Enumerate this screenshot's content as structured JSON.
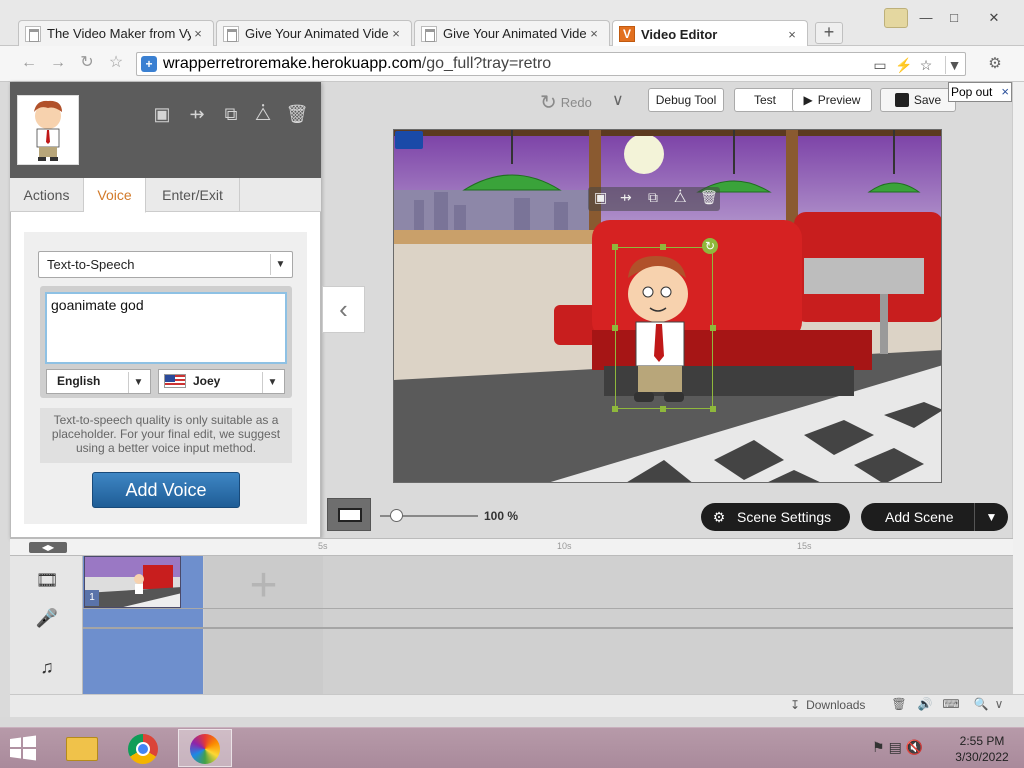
{
  "browser": {
    "tabs": [
      {
        "title": "The Video Maker from Vy",
        "active": false
      },
      {
        "title": "Give Your Animated Videc",
        "active": false
      },
      {
        "title": "Give Your Animated Videc",
        "active": false
      },
      {
        "title": "Video Editor",
        "active": true
      }
    ],
    "tab_close": "×",
    "new_tab": "+",
    "window_controls": {
      "minimize": "—",
      "maximize": "□",
      "close": "✕"
    },
    "url_host": "wrapperretroremake.herokuapp.com",
    "url_path": "/go_full?tray=retro"
  },
  "editor_toolbar": {
    "redo": "Redo",
    "debug_tool": "Debug Tool",
    "test": "Test",
    "preview": "Preview",
    "save": "Save",
    "pop_out": "Pop out",
    "pop_out_close": "×"
  },
  "panel": {
    "tabs": [
      "Actions",
      "Voice",
      "Enter/Exit"
    ],
    "selected_tab": "Voice",
    "voice_source": "Text-to-Speech",
    "tts_text": "goanimate god",
    "language": "English",
    "voice": "Joey",
    "note": "Text-to-speech quality is only suitable as a placeholder. For your final edit, we suggest using a better voice input method.",
    "add_voice": "Add Voice",
    "collapse_glyph": "‹"
  },
  "stage_bar": {
    "zoom_label": "100 %",
    "zoom": 1.0,
    "scene_settings": "Scene Settings",
    "add_scene": "Add Scene"
  },
  "timeline": {
    "ticks": [
      "5s",
      "10s",
      "15s"
    ],
    "scene_number": "1"
  },
  "downloads": {
    "label": "Downloads"
  },
  "taskbar": {
    "time": "2:55 PM",
    "date": "3/30/2022"
  },
  "colors": {
    "accent_tab": "#d27a2a",
    "add_voice": "#2a6fae",
    "selection": "#8fb83c",
    "scene_bg": "#6e8fcd"
  }
}
